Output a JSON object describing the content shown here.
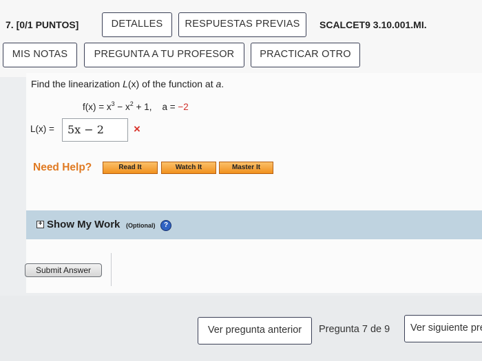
{
  "header": {
    "question_number": "7.",
    "score": "[0/1 PUNTOS]",
    "details_label": "DETALLES",
    "previous_answers_label": "RESPUESTAS PREVIAS",
    "problem_code": "SCALCET9 3.10.001.MI.",
    "my_notes_label": "MIS NOTAS",
    "ask_teacher_label": "PREGUNTA A TU PROFESOR",
    "practice_another_label": "PRACTICAR OTRO"
  },
  "problem": {
    "prompt_prefix": "Find the linearization ",
    "prompt_fn": "L",
    "prompt_mid": "(x) of the function at ",
    "prompt_var": "a",
    "prompt_end": ".",
    "function_lhs": "f(x) = x",
    "exp3": "3",
    "function_mid": " − x",
    "exp2": "2",
    "function_plus": " + 1,",
    "a_label": "a =",
    "a_value": "−2",
    "answer_label": "L(x) =",
    "answer_value": "5x − 2",
    "incorrect_mark": "×"
  },
  "help": {
    "need_help_label": "Need Help?",
    "read_it": "Read It",
    "watch_it": "Watch It",
    "master_it": "Master It"
  },
  "show_my_work": {
    "toggle_symbol": "+",
    "label": "Show My Work",
    "optional": "(Optional)",
    "help_symbol": "?"
  },
  "actions": {
    "submit_label": "Submit Answer"
  },
  "navigation": {
    "previous_label": "Ver pregunta anterior",
    "page_label": "Pregunta 7 de 9",
    "next_label": "Ver siguiente pregunta"
  },
  "colors": {
    "need_help": "#e07a22",
    "incorrect": "#d9342b",
    "show_my_work_bar": "#bfd3e0",
    "help_button": "#f1911e"
  }
}
